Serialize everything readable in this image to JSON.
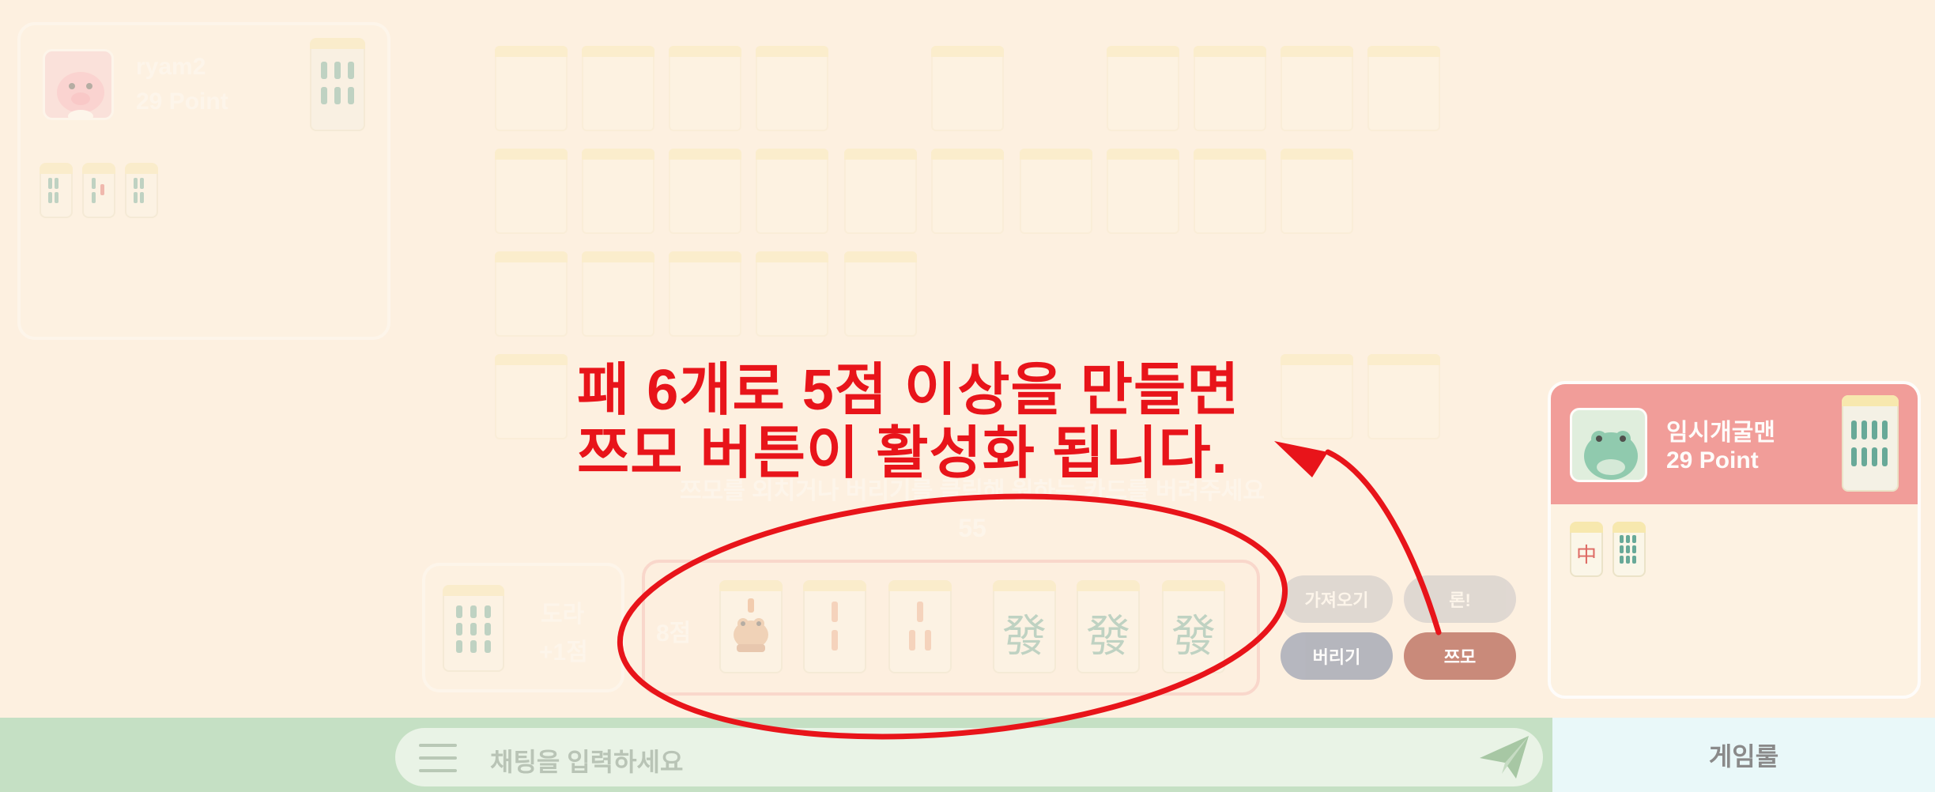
{
  "players": {
    "top_left": {
      "name": "ryam2",
      "points": "29 Point"
    },
    "right": {
      "name": "임시개굴맨",
      "points": "29 Point"
    }
  },
  "board": {
    "instruction": "쯔모를 외치거나 버리기를 클릭해 원하는 카드를 버려주세요",
    "timer": "55"
  },
  "hand": {
    "score": "8점",
    "tiles": [
      {
        "type": "frog"
      },
      {
        "type": "bamboo-2"
      },
      {
        "type": "bamboo-3"
      },
      {
        "type": "green-dragon",
        "glyph": "發"
      },
      {
        "type": "green-dragon",
        "glyph": "發"
      },
      {
        "type": "green-dragon",
        "glyph": "發"
      }
    ]
  },
  "draw_panel": {
    "label": "도라",
    "bonus": "+1점"
  },
  "right_player_discards": {
    "red_dragon": "中"
  },
  "buttons": {
    "fetch": "가져오기",
    "ron": "론!",
    "discard": "버리기",
    "tsumo": "쯔모"
  },
  "chat": {
    "placeholder": "채팅을 입력하세요"
  },
  "rules_button": "게임룰",
  "annotation": {
    "line1": "패 6개로 5점 이상을 만들면",
    "line2": "쯔모 버튼이 활성화 됩니다."
  },
  "colors": {
    "background": "#fdf0e0",
    "annotation_red": "#e8141a",
    "tsumo_button": "#c98a7a",
    "disabled_button": "#a9adb8",
    "active_player_panel": "#ef8f8d",
    "chat_bar": "#c5e0c4",
    "bamboo_green": "#4f9d8c"
  },
  "icons": [
    "menu-icon",
    "send-icon",
    "frog-icon",
    "pig-avatar",
    "frog-avatar"
  ]
}
